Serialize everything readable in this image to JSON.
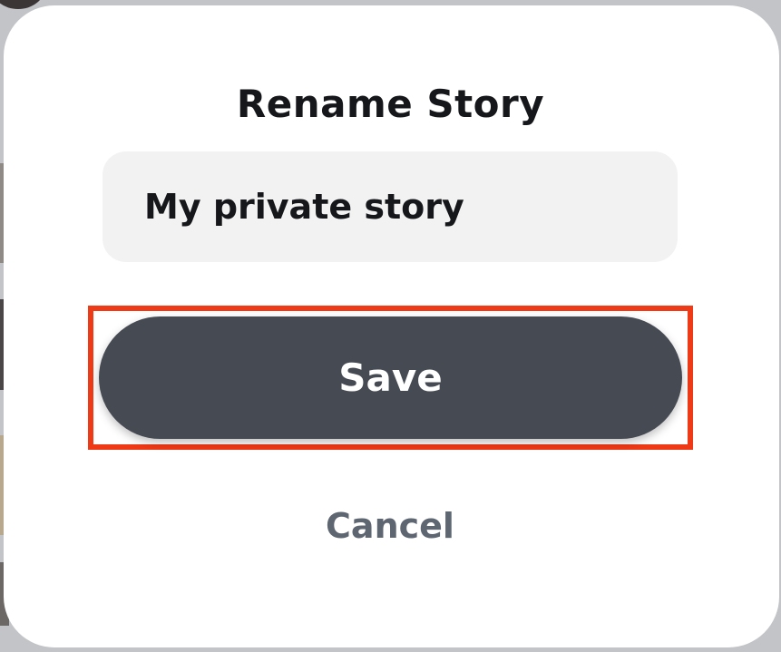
{
  "dialog": {
    "title": "Rename Story",
    "name_input": {
      "value": "My private story"
    },
    "save_label": "Save",
    "cancel_label": "Cancel"
  },
  "colors": {
    "save_button": "#454a53",
    "highlight_border": "#ee3a17",
    "cancel_text": "#5e6672",
    "input_background": "#f2f2f3"
  }
}
